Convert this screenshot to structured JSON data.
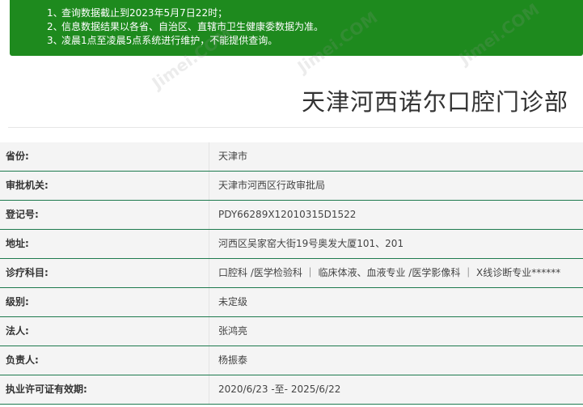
{
  "notice": {
    "items": [
      {
        "num": "1、",
        "text": "查询数据截止到2023年5月7日22时；"
      },
      {
        "num": "2、",
        "text": "信息数据结果以各省、自治区、直辖市卫生健康委数据为准。"
      },
      {
        "num": "3、",
        "text": "凌晨1点至凌晨5点系统进行维护，不能提供查询。"
      }
    ]
  },
  "page": {
    "title": "天津河西诺尔口腔门诊部"
  },
  "details": [
    {
      "label": "省份:",
      "value": "天津市"
    },
    {
      "label": "审批机关:",
      "value": "天津市河西区行政审批局"
    },
    {
      "label": "登记号:",
      "value": "PDY66289X12010315D1522"
    },
    {
      "label": "地址:",
      "value": "河西区吴家窑大街19号奥发大厦101、201"
    },
    {
      "label": "诊疗科目:",
      "value": "口腔科 /医学检验科 ｜ 临床体液、血液专业 /医学影像科 ｜ X线诊断专业******"
    },
    {
      "label": "级别:",
      "value": "未定级"
    },
    {
      "label": "法人:",
      "value": "张鸿亮"
    },
    {
      "label": "负责人:",
      "value": "杨振泰"
    },
    {
      "label": "执业许可证有效期:",
      "value": "2020/6/23 -至- 2025/6/22"
    }
  ],
  "watermark": {
    "text": "Jimei.COM"
  },
  "colors": {
    "notice_bg": "#1e8a1e",
    "row_border": "#1e7a4e"
  }
}
